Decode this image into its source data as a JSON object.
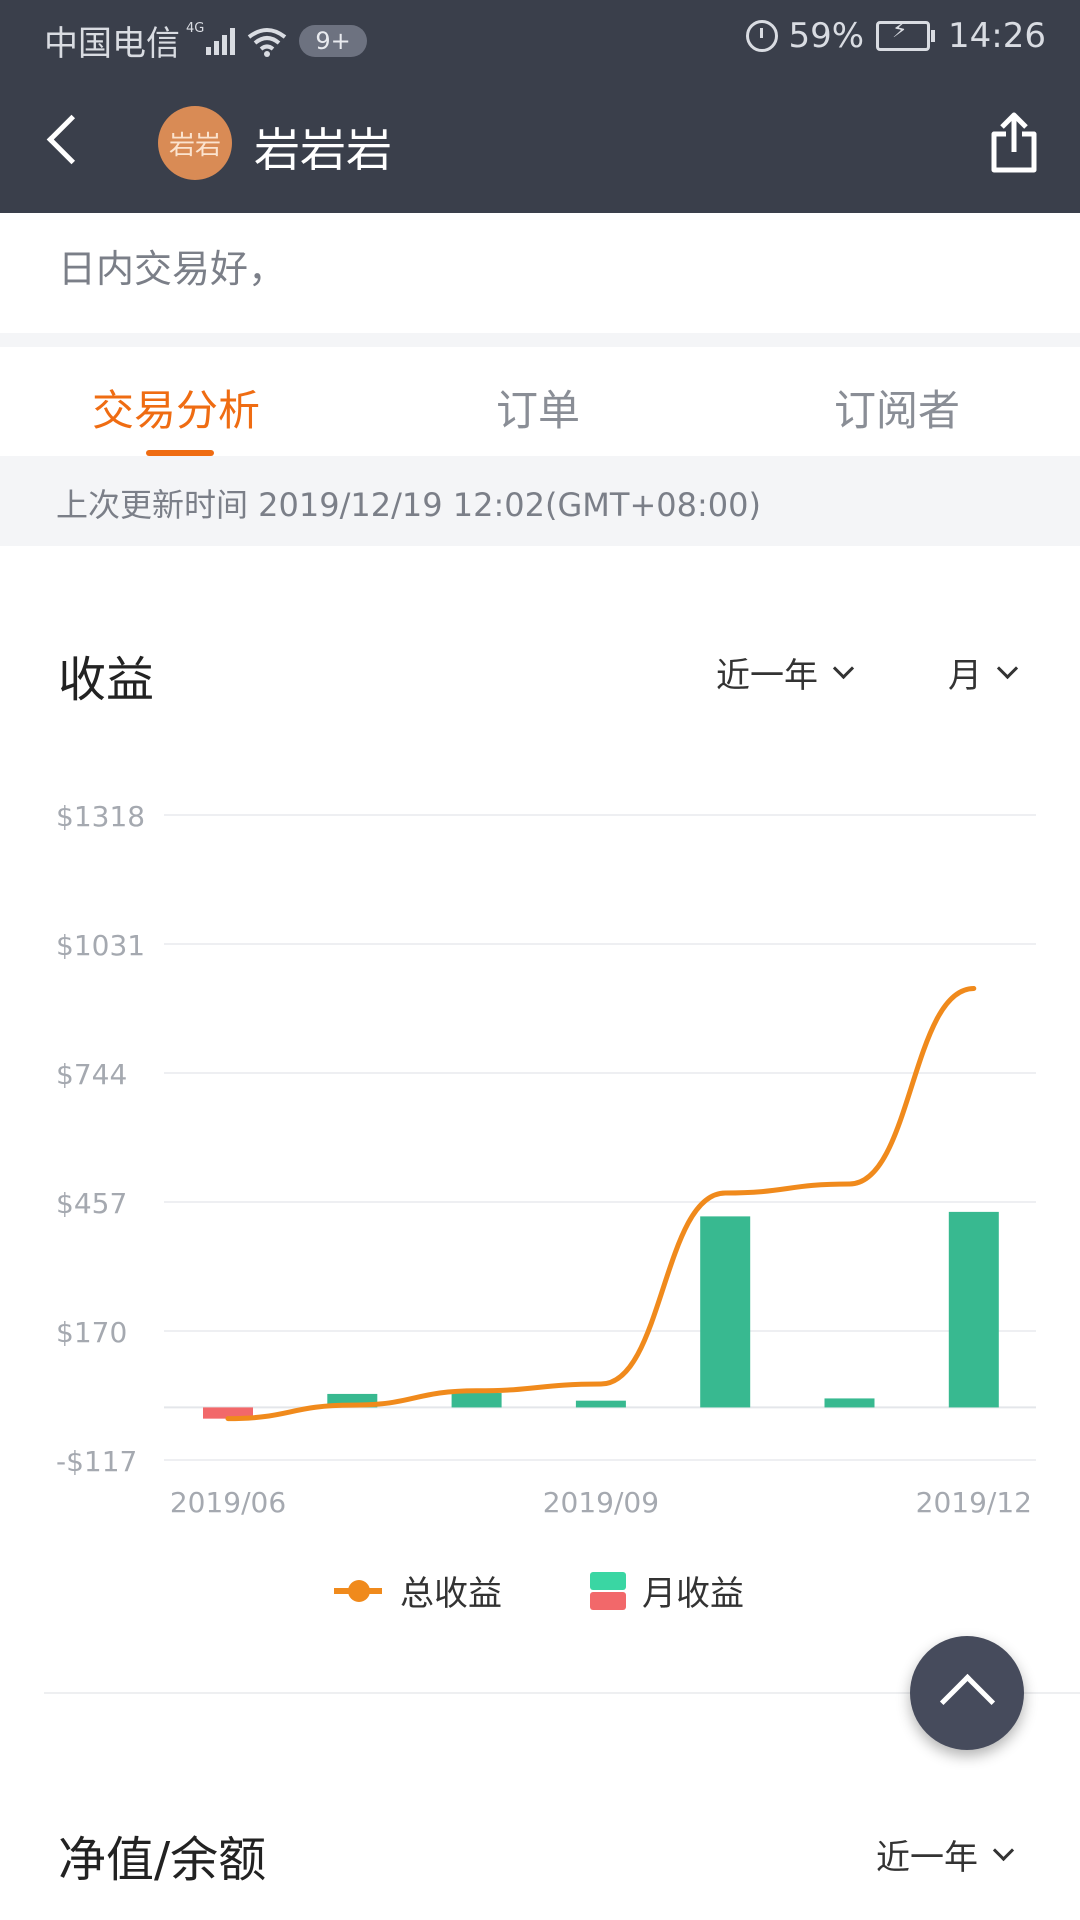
{
  "status_bar": {
    "carrier": "中国电信",
    "network": "4G",
    "notification_count": "9+",
    "battery": "59%",
    "time": "14:26"
  },
  "header": {
    "avatar_text": "岩岩",
    "username": "岩岩岩"
  },
  "bio": "日内交易好，",
  "tabs": [
    {
      "label": "交易分析",
      "active": true
    },
    {
      "label": "订单",
      "active": false
    },
    {
      "label": "订阅者",
      "active": false
    }
  ],
  "last_update": "上次更新时间 2019/12/19 12:02(GMT+08:00)",
  "earnings": {
    "title": "收益",
    "range_filter": "近一年",
    "period_filter": "月"
  },
  "chart_data": {
    "type": "bar",
    "y_ticks": [
      "$1318",
      "$1031",
      "$744",
      "$457",
      "$170",
      "-$117"
    ],
    "y_tick_values": [
      1318,
      1031,
      744,
      457,
      170,
      -117
    ],
    "ylim": [
      -117,
      1318
    ],
    "x_tick_labels": [
      "2019/06",
      "2019/09",
      "2019/12"
    ],
    "categories": [
      "2019/06",
      "2019/07",
      "2019/08",
      "2019/09",
      "2019/10",
      "2019/11",
      "2019/12"
    ],
    "series": [
      {
        "name": "月收益",
        "type": "bar",
        "values": [
          -25,
          30,
          32,
          15,
          425,
          20,
          435
        ],
        "colors": {
          "positive": "#38b990",
          "negative": "#f2686a"
        }
      },
      {
        "name": "总收益",
        "type": "line",
        "values": [
          -25,
          5,
          37,
          52,
          477,
          497,
          932
        ],
        "color": "#f08a1c"
      }
    ],
    "grid": true
  },
  "legend": {
    "total_label": "总收益",
    "monthly_label": "月收益"
  },
  "net_section": {
    "title": "净值/余额",
    "range_filter": "近一年"
  }
}
